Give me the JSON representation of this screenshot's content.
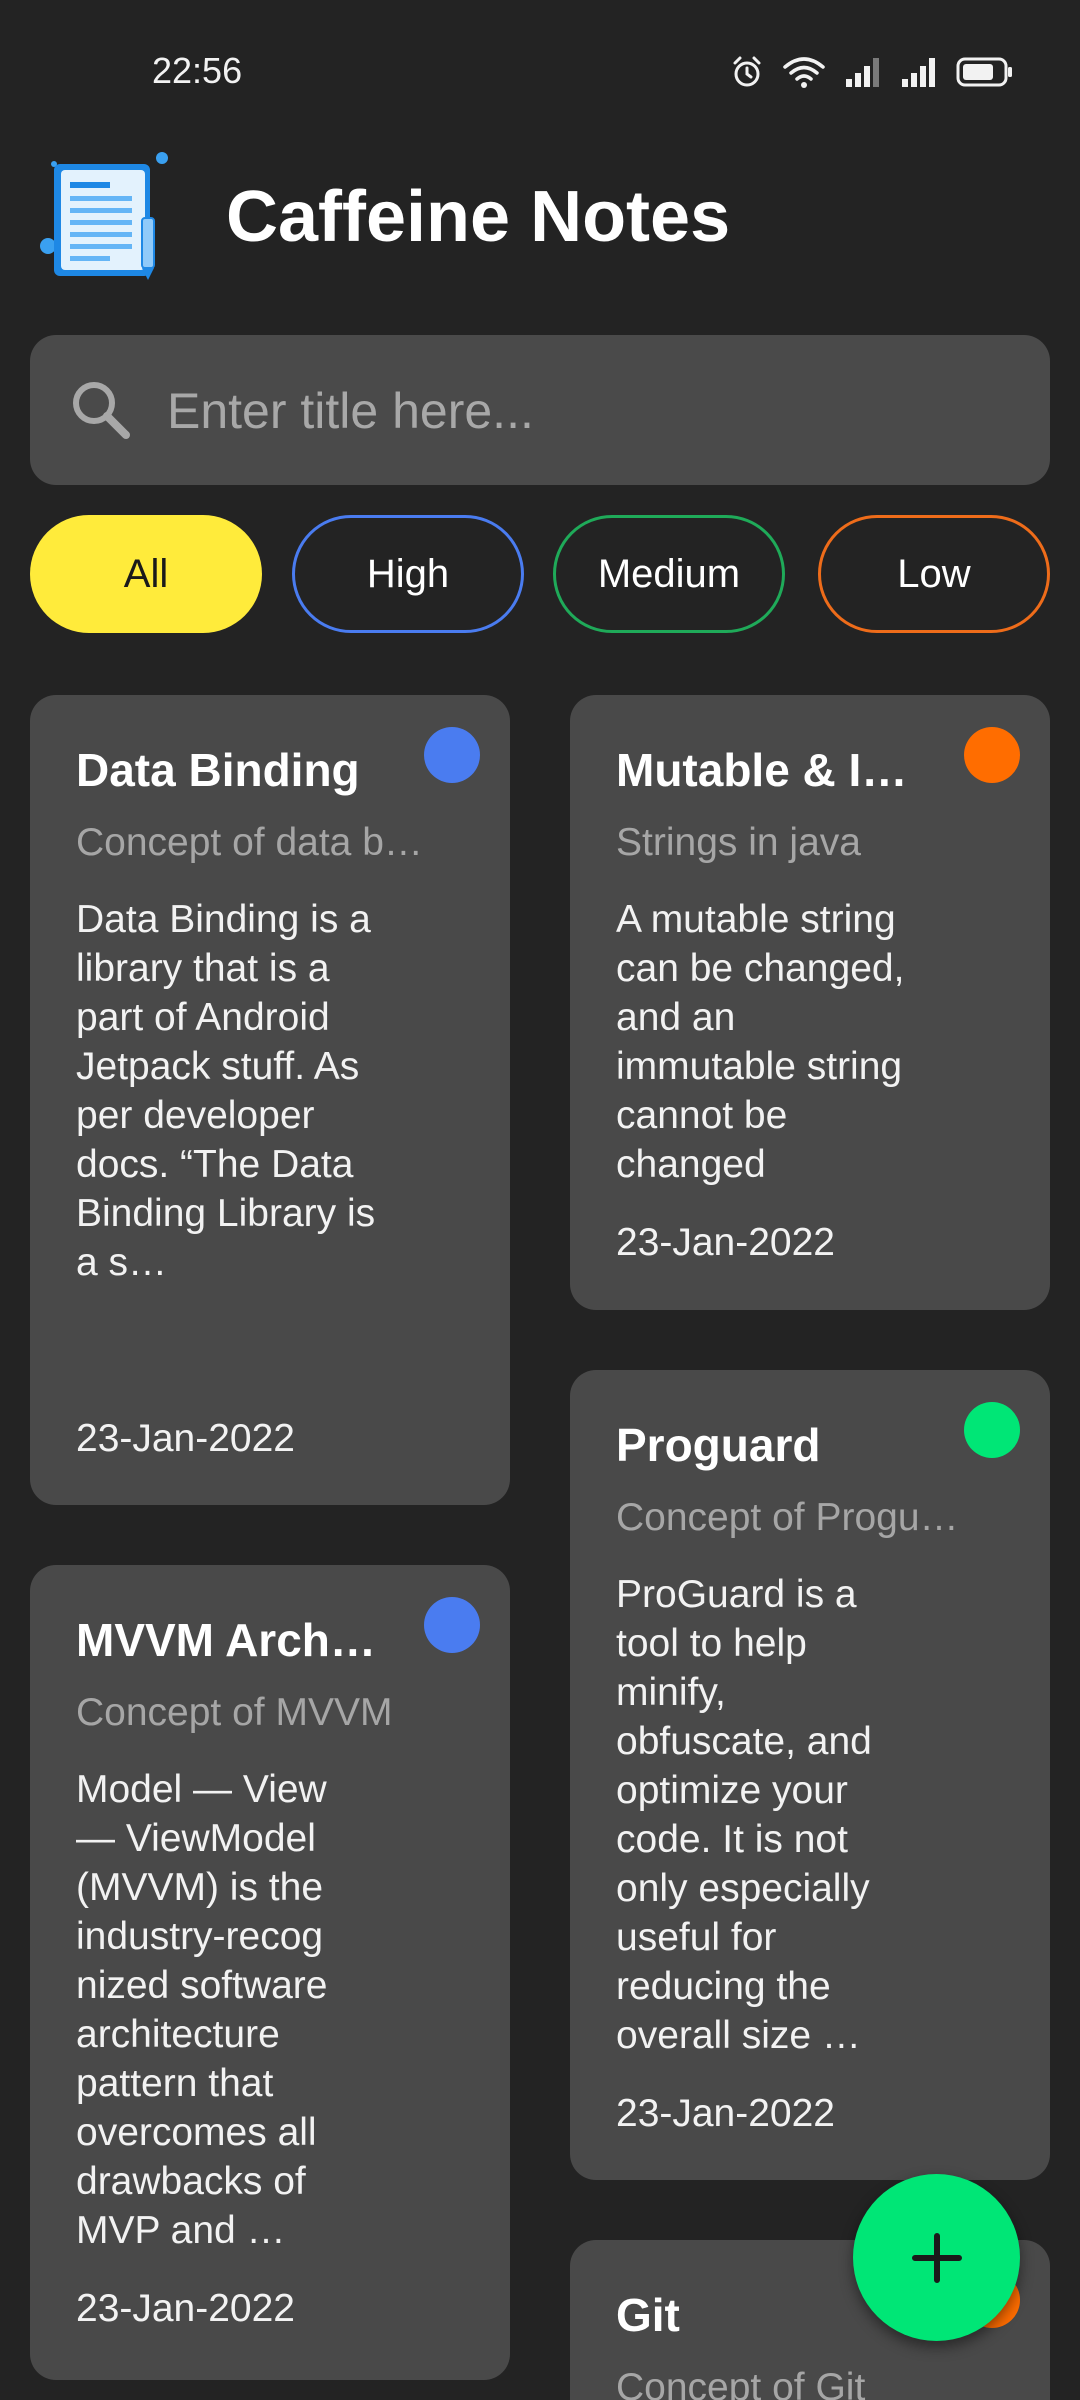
{
  "status_bar": {
    "time": "22:56"
  },
  "header": {
    "title": "Caffeine Notes",
    "logo_icon": "notes-document-icon"
  },
  "search": {
    "placeholder": "Enter title here...",
    "value": ""
  },
  "filters": [
    "All",
    "High",
    "Medium",
    "Low"
  ],
  "colors": {
    "background": "#232323",
    "card": "#494949",
    "selected_chip": "#ffeb3b",
    "high": "#4a7cf0",
    "medium": "#1faa59",
    "low": "#ee6c1a",
    "fab": "#00e676"
  },
  "notes": [
    {
      "title": "Data Binding",
      "subtitle": "Concept of data b…",
      "body": "Data Binding is a library that is a part of Android Jetpack stuff. As per developer docs. “The Data Binding Library is a s…",
      "date": "23-Jan-2022",
      "priority_color": "#4a7cf0"
    },
    {
      "title": "Mutable & I…",
      "subtitle": "Strings in java",
      "body": "A mutable string can be changed, and an immutable string cannot be changed",
      "date": "23-Jan-2022",
      "priority_color": "#ff6d00"
    },
    {
      "title": "Proguard",
      "subtitle": "Concept of Progu…",
      "body": "ProGuard is a tool to help minify, obfuscate, and optimize your code. It is not only especially useful for reducing the overall size …",
      "date": "23-Jan-2022",
      "priority_color": "#00e676"
    },
    {
      "title": "MVVM Arch…",
      "subtitle": "Concept of MVVM",
      "body": "Model — View — ViewModel (MVVM) is the industry-recog nized software architecture pattern that overcomes all drawbacks of MVP and …",
      "date": "23-Jan-2022",
      "priority_color": "#4a7cf0"
    },
    {
      "title": "Git",
      "subtitle": "Concept of Git",
      "priority_color": "#ff6d00"
    }
  ],
  "fab": {
    "icon": "plus-icon"
  }
}
